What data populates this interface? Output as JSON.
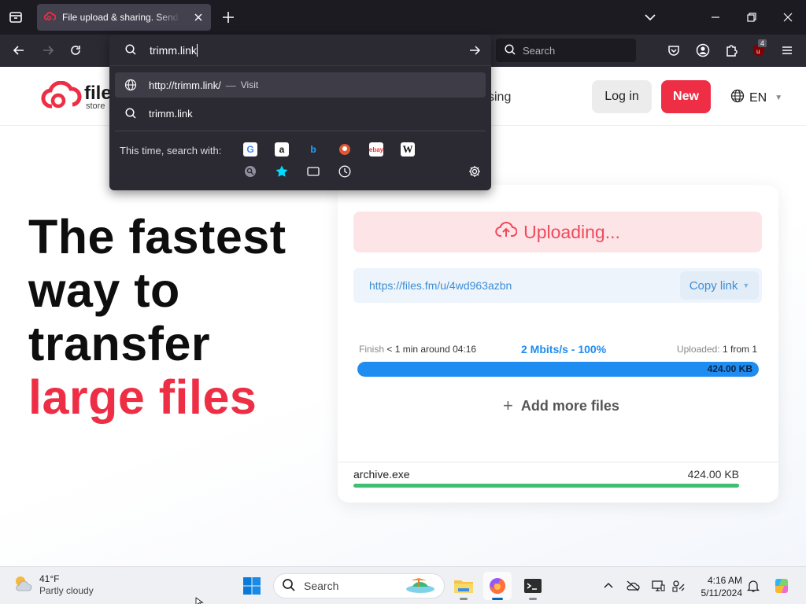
{
  "browser": {
    "tab_title": "File upload & sharing. Send large files",
    "url_input": "trimm.link",
    "search_placeholder": "Search",
    "ublock_badge": "4"
  },
  "url_popup": {
    "suggestions": [
      {
        "text": "http://trimm.link/",
        "separator": "—",
        "action": "Visit"
      },
      {
        "text": "trimm.link"
      }
    ],
    "search_with_label": "This time, search with:",
    "engines": [
      "google-icon",
      "amazon-icon",
      "bing-icon",
      "duckduckgo-icon",
      "ebay-icon",
      "wikipedia-icon",
      "search-engine-icon",
      "bookmarks-icon",
      "tabs-icon",
      "history-icon"
    ]
  },
  "site": {
    "logo_text": "file",
    "logo_sub": "store",
    "nav_partial": "sing",
    "login_label": "Log in",
    "new_label": "New",
    "lang_label": "EN",
    "hero_line1": "The fastest",
    "hero_line2": "way to",
    "hero_line3": "transfer",
    "hero_line4": "large files",
    "accent_color": "#ee2e45"
  },
  "upload": {
    "status": "Uploading...",
    "link": "https://files.fm/u/4wd963azbn",
    "copy_label": "Copy link",
    "finish_label": "Finish",
    "finish_value": "< 1 min around 04:16",
    "speed": "2 Mbits/s - 100%",
    "uploaded_label": "Uploaded:",
    "uploaded_value": "1 from 1",
    "progress_percent": 100,
    "progress_size": "424.00 KB",
    "add_more_label": "Add more files",
    "file_name": "archive.exe",
    "file_size": "424.00 KB",
    "file_progress_percent": 100
  },
  "taskbar": {
    "temperature": "41°F",
    "condition": "Partly cloudy",
    "search_label": "Search",
    "time": "4:16 AM",
    "date": "5/11/2024"
  }
}
